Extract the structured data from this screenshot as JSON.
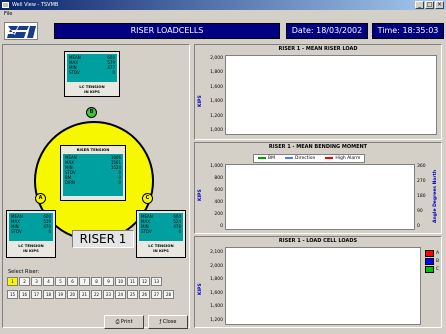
{
  "window": {
    "title": "Well View - TSVMB",
    "menu": "File"
  },
  "header": {
    "title": "RISER LOADCELLS",
    "date": "Date: 18/03/2002",
    "time": "Time: 18:35:03"
  },
  "top_cell": {
    "marker": "B",
    "rows": [
      [
        "MEAN",
        "600"
      ],
      [
        "MAX",
        "579"
      ],
      [
        "MIN",
        "477"
      ],
      [
        "STDV",
        "0"
      ]
    ],
    "caption1": "LC TENSION",
    "caption2": "IN KIPS"
  },
  "center_cell": {
    "title": "RISER TENSION",
    "rows": [
      [
        "MEAN",
        "1606"
      ],
      [
        "MAX",
        "1561"
      ],
      [
        "MIN",
        "1524"
      ],
      [
        "STDV",
        "0"
      ],
      [
        "BM",
        "0"
      ],
      [
        "DIRN",
        "0"
      ]
    ]
  },
  "left_cell": {
    "marker": "A",
    "rows": [
      [
        "MEAN",
        "600"
      ],
      [
        "MAX",
        "519"
      ],
      [
        "MIN",
        "470"
      ],
      [
        "STDV",
        "0"
      ]
    ],
    "caption1": "LC TENSION",
    "caption2": "IN KIPS"
  },
  "right_cell": {
    "marker": "C",
    "rows": [
      [
        "MEAN",
        "600"
      ],
      [
        "MAX",
        "524"
      ],
      [
        "MIN",
        "478"
      ],
      [
        "STDV",
        "0"
      ]
    ],
    "caption1": "LC TENSION",
    "caption2": "IN KIPS"
  },
  "riser_label": "RISER 1",
  "select_riser": {
    "label": "Select Riser:",
    "row1": [
      "1",
      "2",
      "3",
      "4",
      "5",
      "6",
      "7",
      "8",
      "9",
      "10",
      "11",
      "12",
      "13"
    ],
    "row2": [
      "15",
      "16",
      "17",
      "18",
      "19",
      "20",
      "21",
      "22",
      "23",
      "24",
      "25",
      "26",
      "27",
      "28"
    ],
    "selected": "1"
  },
  "buttons": {
    "print": "Print",
    "close": "Close"
  },
  "charts": {
    "mean_load": {
      "title": "RISER 1 - MEAN RISER LOAD",
      "ylabel": "KIPS",
      "yticks": [
        "2,000",
        "1,800",
        "1,600",
        "1,400",
        "1,200",
        "1,000"
      ]
    },
    "bending": {
      "title": "RISER 1 - MEAN BENDING MOMENT",
      "ylabel": "KIPS",
      "ylabel_right": "Angle Degrees North",
      "yticks": [
        "1,000",
        "800",
        "600",
        "400",
        "200",
        "0"
      ],
      "yticks_right": [
        "360",
        "270",
        "180",
        "90",
        "0"
      ],
      "legend": [
        {
          "name": "BM",
          "color": "#00a000"
        },
        {
          "name": "Direction",
          "color": "#4080ff"
        },
        {
          "name": "High Alarm",
          "color": "#ff0000"
        }
      ]
    },
    "loadcell": {
      "title": "RISER 1 - LOAD CELL LOADS",
      "ylabel": "KIPS",
      "yticks": [
        "2,100",
        "2,000",
        "1,800",
        "1,600",
        "1,400",
        "1,200"
      ],
      "legend": [
        {
          "name": "A",
          "color": "#ff0000"
        },
        {
          "name": "B",
          "color": "#0000ff"
        },
        {
          "name": "C",
          "color": "#00c000"
        }
      ]
    }
  },
  "colors": {
    "header_bg": "#000080",
    "circle": "#f7f700",
    "lc_data": "#00a0a0",
    "marker_b": "#33cc33",
    "marker_ac": "#f7f700"
  }
}
